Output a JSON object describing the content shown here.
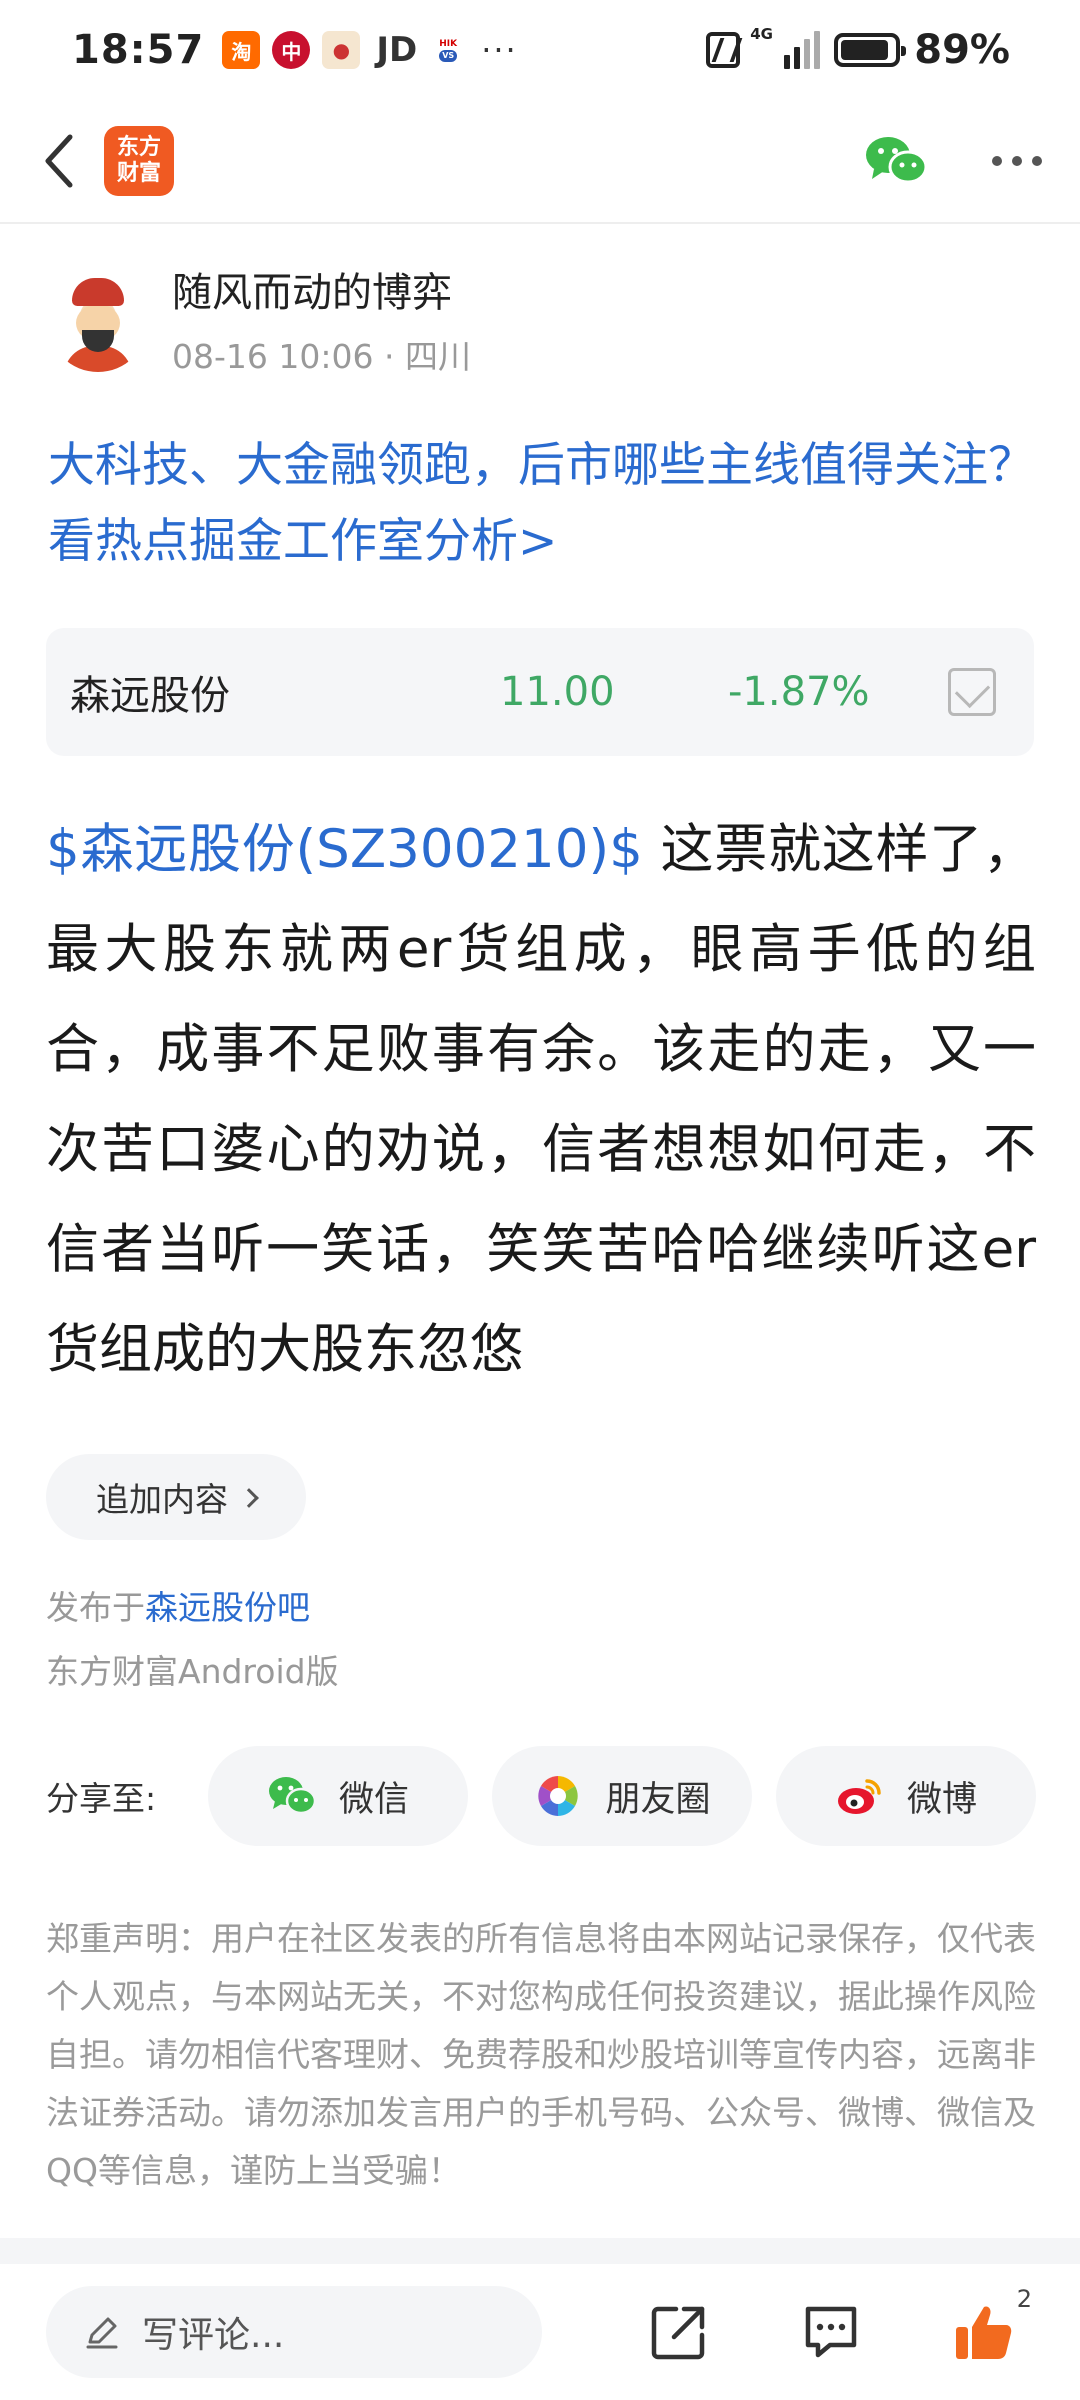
{
  "status_bar": {
    "time": "18:57",
    "app_icons": [
      "taobao-icon",
      "bank-of-china-icon",
      "cartoon-app-icon",
      "jd-icon",
      "hikvision-icon"
    ],
    "jd_label": "JD",
    "overflow": "···",
    "network": "4G",
    "battery_percent": "89%",
    "battery_level": 0.89
  },
  "nav": {
    "brand_line1": "东方",
    "brand_line2": "财富"
  },
  "author": {
    "name": "随风而动的博弈",
    "meta": "08-16 10:06 · 四川"
  },
  "headline": "大科技、大金融领跑，后市哪些主线值得关注？看热点掘金工作室分析>",
  "stock_card": {
    "name": "森远股份",
    "price": "11.00",
    "change": "-1.87%"
  },
  "post": {
    "stock_tag": "$森远股份(SZ300210)$",
    "text": " 这票就这样了，最大股东就两er货组成，眼高手低的组合，成事不足败事有余。该走的走，又一次苦口婆心的劝说，信者想想如何走，不信者当听一笑话，笑笑苦哈哈继续听这er货组成的大股东忽悠"
  },
  "append_label": "追加内容",
  "publish": {
    "prefix": "发布于",
    "bar_name": "森远股份吧",
    "client": "东方财富Android版"
  },
  "share": {
    "label": "分享至:",
    "wechat": "微信",
    "moments": "朋友圈",
    "weibo": "微博"
  },
  "disclaimer": "郑重声明：用户在社区发表的所有信息将由本网站记录保存，仅代表个人观点，与本网站无关，不对您构成任何投资建议，据此操作风险自担。请勿相信代客理财、免费荐股和炒股培训等宣传内容，远离非法证券活动。请勿添加发言用户的手机号码、公众号、微博、微信及QQ等信息，谨防上当受骗！",
  "bottom_bar": {
    "comment_placeholder": "写评论...",
    "like_count": "2"
  },
  "colors": {
    "link_blue": "#2a6bcf",
    "stock_green": "#3fa865",
    "brand_orange": "#f05a22",
    "like_orange": "#f26a1f",
    "wechat_green": "#3dbb4c"
  }
}
